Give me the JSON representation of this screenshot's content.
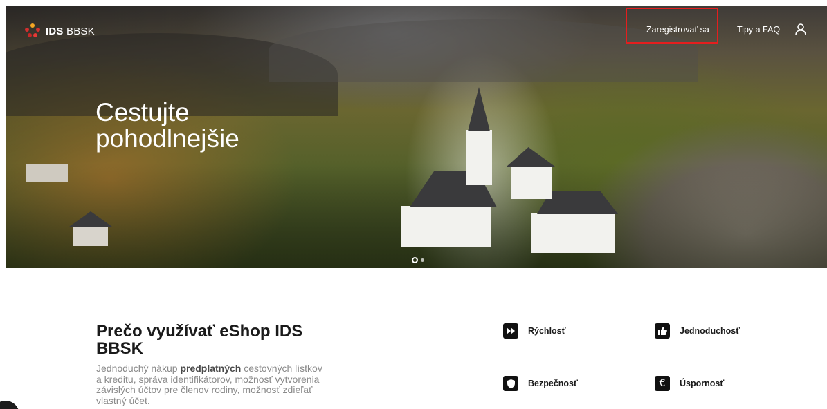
{
  "header": {
    "logo_bold": "IDS",
    "logo_rest": "BBSK",
    "nav": {
      "register": "Zaregistrovať sa",
      "faq": "Tipy a FAQ"
    }
  },
  "hero": {
    "title_line1": "Cestujte",
    "title_line2": "pohodlnejšie",
    "slides_total": 2,
    "slide_active": 1
  },
  "section": {
    "title": "Prečo využívať eShop IDS BBSK",
    "desc_part1": "Jednoduchý nákup ",
    "desc_bold": "predplatných",
    "desc_part2": " cestovných lístkov a kreditu, správa identifikátorov, možnosť vytvorenia závislých účtov pre členov rodiny, možnosť zdieľať vlastný účet."
  },
  "features": [
    {
      "label": "Rýchlosť",
      "icon": "fast-forward-icon"
    },
    {
      "label": "Jednoduchosť",
      "icon": "thumbs-up-icon"
    },
    {
      "label": "Bezpečnosť",
      "icon": "shield-icon"
    },
    {
      "label": "Úspornosť",
      "icon": "euro-icon"
    }
  ],
  "colors": {
    "highlight_border": "#e41e1e",
    "icon_bg": "#111111",
    "text_muted": "#8a8a8a"
  }
}
